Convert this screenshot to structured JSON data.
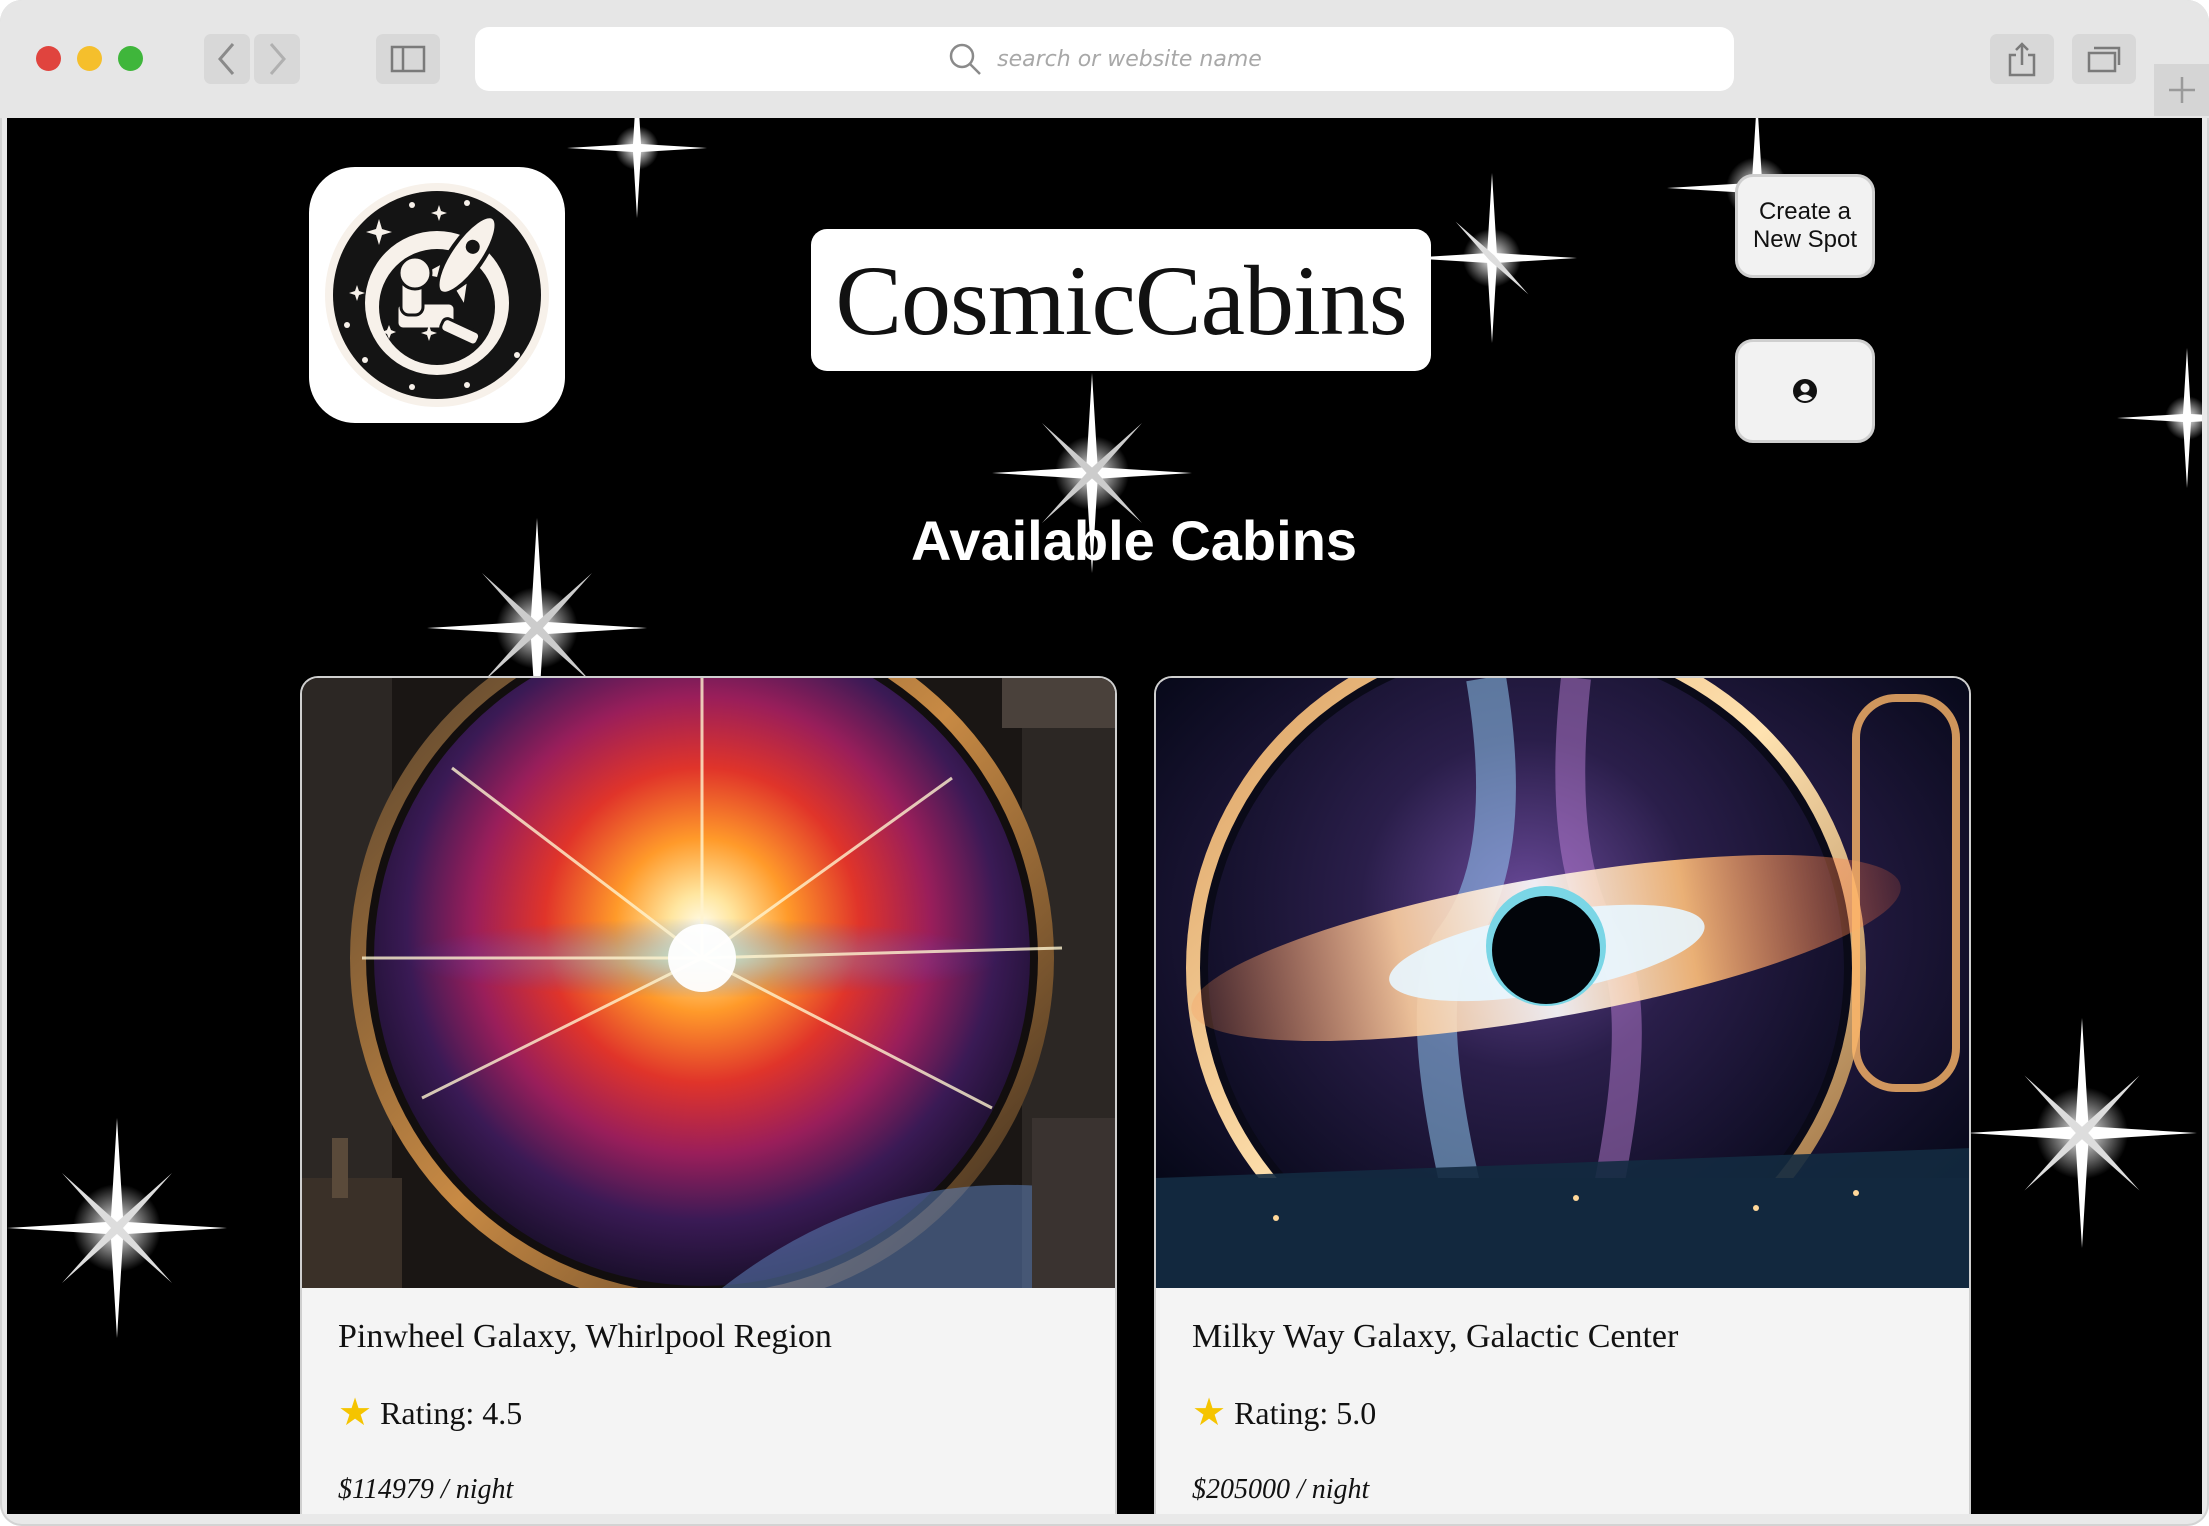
{
  "browser": {
    "address_placeholder": "search or website name"
  },
  "header": {
    "brand_name": "CosmicCabins",
    "create_button_label": "Create a New Spot"
  },
  "main": {
    "heading": "Available Cabins",
    "listings": [
      {
        "title": "Pinwheel Galaxy, Whirlpool Region",
        "rating_text": "Rating: 4.5",
        "price_text": "$114979 / night",
        "rating": 4.5
      },
      {
        "title": "Milky Way Galaxy, Galactic Center",
        "rating_text": "Rating: 5.0",
        "price_text": "$205000 / night",
        "rating": 5.0
      }
    ]
  },
  "icons": {
    "back": "chevron-left-icon",
    "forward": "chevron-right-icon",
    "sidebar": "sidebar-icon",
    "search": "search-icon",
    "share": "share-icon",
    "tabs": "tabs-icon",
    "new_tab": "plus-icon",
    "profile": "user-circle-icon",
    "rating": "star-icon"
  },
  "colors": {
    "page_background": "#000000",
    "card_background": "#f4f4f4",
    "star_rating": "#f5c400",
    "button_background": "#f2f2f2"
  }
}
